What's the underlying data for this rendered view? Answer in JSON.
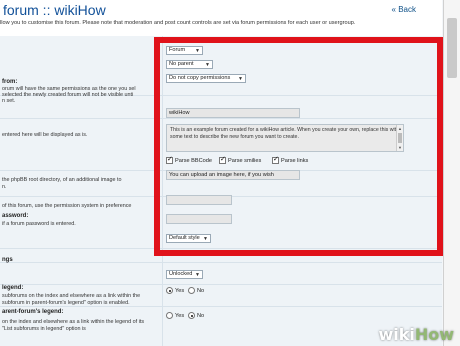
{
  "header": {
    "title": "forum :: wikiHow",
    "back_link": "« Back",
    "intro": "llow you to customise this forum. Please note that moderation and post count controls are set via forum permissions for each user or usergroup."
  },
  "labels": {
    "copy_from_heading": "from:",
    "copy_from_line1": "orum will have the same permissions as the one you sel",
    "copy_from_line2": "selected the newly created forum will not be visible unti",
    "copy_from_line3": "n set.",
    "name_desc": "entered here will be displayed as is.",
    "image_line1": "the phpBB root directory, of an additional image to",
    "image_line2": "n.",
    "password_line1": "of this forum, use the permission system in preference",
    "password_heading": "assword:",
    "password_line2": "if a forum password is entered.",
    "settings_heading": "ngs",
    "legend_heading": "legend:",
    "legend_line1": "subforums on the index and elsewhere as a link within the",
    "legend_line2": "subforum in parent-forum's legend\" option is enabled.",
    "parent_legend_heading": "arent-forum's legend:",
    "parent_legend_line1": "on the index and elsewhere as a link within the legend of its",
    "parent_legend_line2": "\"List subforums in legend\" option is"
  },
  "form": {
    "forum_type": "Forum",
    "parent": "No parent",
    "copy_permissions": "Do not copy permissions",
    "forum_name": "wikiHow",
    "description": "This is an example forum created for a wikiHow article. When you create your own, replace this with some text to describe the new forum you want to create.",
    "parse_bbcode": "Parse BBCode",
    "parse_smilies": "Parse smilies",
    "parse_links": "Parse links",
    "image_path": "You can upload an image here, if you wish",
    "password": "",
    "password_confirm": "",
    "style": "Default style",
    "status": "Unlocked",
    "yes": "Yes",
    "no": "No",
    "yes2": "Yes",
    "no2": "No"
  },
  "watermark": {
    "wiki": "wiki",
    "how": "How"
  },
  "colors": {
    "highlight": "#e0121a",
    "title": "#115098"
  }
}
